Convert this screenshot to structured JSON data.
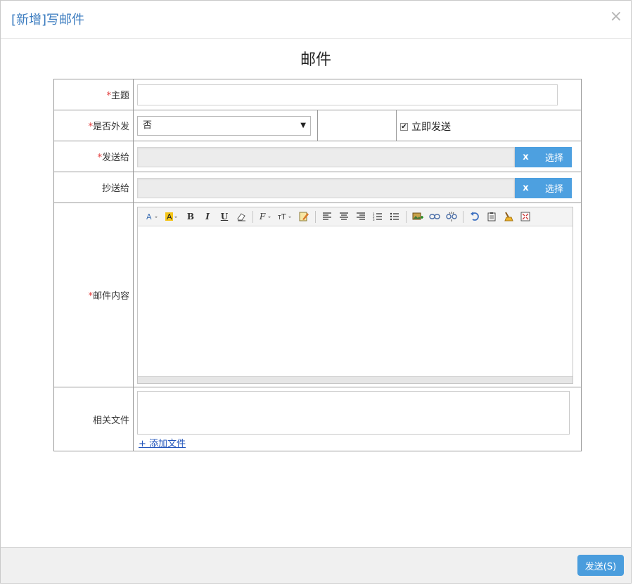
{
  "dialog": {
    "title": "[新增]写邮件",
    "close_symbol": "×"
  },
  "form": {
    "heading": "邮件",
    "required_mark": "*",
    "subject": {
      "label": "主题",
      "value": ""
    },
    "external": {
      "label": "是否外发",
      "selected": "否"
    },
    "send_now": {
      "label": "立即发送",
      "checked": true,
      "check_mark": "✔"
    },
    "to": {
      "label": "发送给",
      "value": "",
      "clear_label": "x",
      "select_label": "选择"
    },
    "cc": {
      "label": "抄送给",
      "value": "",
      "clear_label": "x",
      "select_label": "选择"
    },
    "content": {
      "label": "邮件内容",
      "value": ""
    },
    "files": {
      "label": "相关文件",
      "add_label": "+ 添加文件"
    }
  },
  "toolbar_icons": [
    "font-color-icon",
    "highlight-color-icon",
    "bold-icon",
    "italic-icon",
    "underline-icon",
    "eraser-icon",
    "font-family-icon",
    "font-size-icon",
    "paint-icon",
    "align-left-icon",
    "align-center-icon",
    "align-right-icon",
    "ordered-list-icon",
    "unordered-list-icon",
    "insert-image-icon",
    "link-icon",
    "unlink-icon",
    "undo-icon",
    "paste-icon",
    "clean-icon",
    "fullscreen-icon"
  ],
  "footer": {
    "send_label": "发送(S)"
  },
  "colors": {
    "title": "#3a7bbf",
    "required": "#e23b3b",
    "button": "#4da0e0",
    "link": "#2255bb"
  }
}
